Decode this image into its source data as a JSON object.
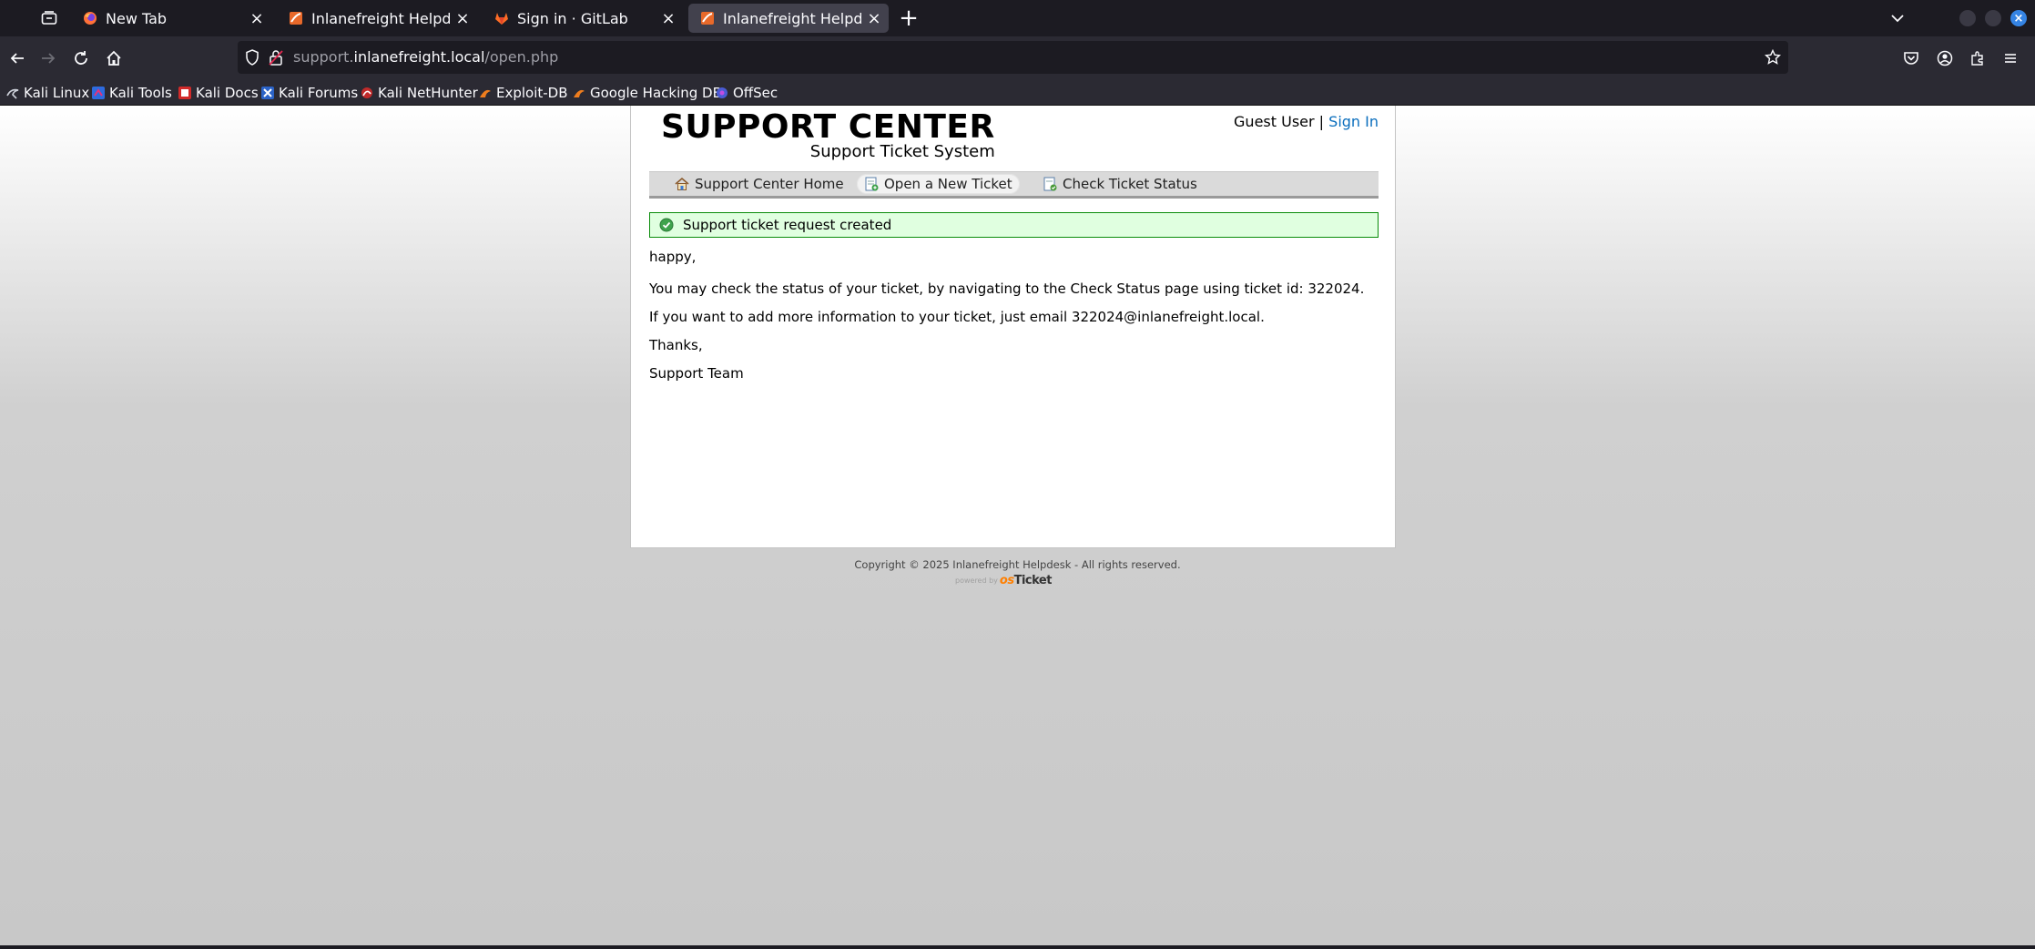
{
  "browser": {
    "tabs": [
      {
        "title": "New Tab",
        "active": false,
        "icon": "firefox-icon"
      },
      {
        "title": "Inlanefreight Helpdesk",
        "active": false,
        "icon": "helpdesk-icon"
      },
      {
        "title": "Sign in · GitLab",
        "active": false,
        "icon": "gitlab-icon"
      },
      {
        "title": "Inlanefreight Helpdesk",
        "active": true,
        "icon": "helpdesk-icon"
      }
    ],
    "url": {
      "prefix": "support.",
      "domain": "inlanefreight.local",
      "path": "/open.php"
    },
    "bookmarks": [
      {
        "label": "Kali Linux",
        "icon": "kali-icon"
      },
      {
        "label": "Kali Tools",
        "icon": "kali-tools-icon"
      },
      {
        "label": "Kali Docs",
        "icon": "kali-docs-icon"
      },
      {
        "label": "Kali Forums",
        "icon": "kali-forums-icon"
      },
      {
        "label": "Kali NetHunter",
        "icon": "nethunter-icon"
      },
      {
        "label": "Exploit-DB",
        "icon": "exploit-db-icon"
      },
      {
        "label": "Google Hacking DB",
        "icon": "ghdb-icon"
      },
      {
        "label": "OffSec",
        "icon": "offsec-icon"
      }
    ]
  },
  "page": {
    "logo_title": "SUPPORT CENTER",
    "logo_subtitle": "Support Ticket System",
    "user": {
      "name": "Guest User",
      "separator": "|",
      "sign_in": "Sign In"
    },
    "nav": [
      {
        "label": "Support Center Home",
        "active": false
      },
      {
        "label": "Open a New Ticket",
        "active": true
      },
      {
        "label": "Check Ticket Status",
        "active": false
      }
    ],
    "notice": "Support ticket request created",
    "message": {
      "greeting": "happy,",
      "status_line": "You may check the status of your ticket, by navigating to the Check Status page using ticket id: 322024.",
      "email_line": "If you want to add more information to your ticket, just email 322024@inlanefreight.local.",
      "thanks": "Thanks,",
      "signature": "Support Team"
    },
    "footer": {
      "copyright": "Copyright © 2025 Inlanefreight Helpdesk - All rights reserved.",
      "powered_by": "powered by",
      "brand_os": "os",
      "brand_ticket": "Ticket"
    }
  },
  "colors": {
    "link": "#0a6ebd",
    "notice_bg": "#e0ffe0",
    "notice_border": "#0a8c0a",
    "accent": "#3584e4"
  }
}
